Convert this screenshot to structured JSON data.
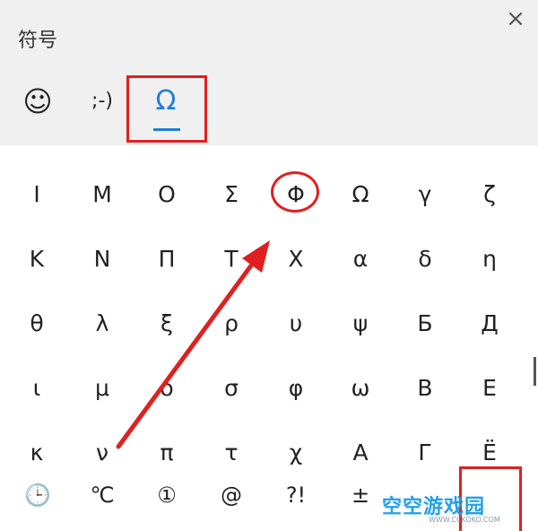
{
  "header": {
    "title": "符号",
    "close_glyph": "×"
  },
  "tabs": [
    {
      "name": "emoji",
      "glyph": "☺",
      "icon": "smiley-icon"
    },
    {
      "name": "kaomoji",
      "glyph": ";-)",
      "icon": "kaomoji-icon"
    },
    {
      "name": "symbols",
      "glyph": "Ω",
      "icon": "omega-icon",
      "selected": true
    }
  ],
  "symbols": [
    [
      "Ι",
      "Μ",
      "Ο",
      "Σ",
      "Φ",
      "Ω",
      "γ",
      "ζ"
    ],
    [
      "Κ",
      "Ν",
      "Π",
      "Τ",
      "Χ",
      "α",
      "δ",
      "η"
    ],
    [
      "θ",
      "λ",
      "ξ",
      "ρ",
      "υ",
      "ψ",
      "Б",
      "Д"
    ],
    [
      "ι",
      "μ",
      "ο",
      "σ",
      "φ",
      "ω",
      "В",
      "Е"
    ],
    [
      "κ",
      "ν",
      "π",
      "τ",
      "χ",
      "А",
      "Г",
      "Ё"
    ]
  ],
  "bottom_tabs": [
    {
      "glyph": "🕒",
      "icon": "recent-clock-icon"
    },
    {
      "glyph": "℃",
      "icon": "celsius-icon"
    },
    {
      "glyph": "①",
      "icon": "circled-one-icon"
    },
    {
      "glyph": "@",
      "icon": "at-sign-icon"
    },
    {
      "glyph": "?!",
      "icon": "punctuation-icon"
    },
    {
      "glyph": "±",
      "icon": "math-symbols-icon"
    }
  ],
  "watermark": {
    "text": "空空游戏园",
    "sub": "WWW.CCKOKO.COM"
  },
  "colors": {
    "accent": "#1e7fd6",
    "annotation": "#e02020",
    "header_bg": "#f0f0f0"
  }
}
